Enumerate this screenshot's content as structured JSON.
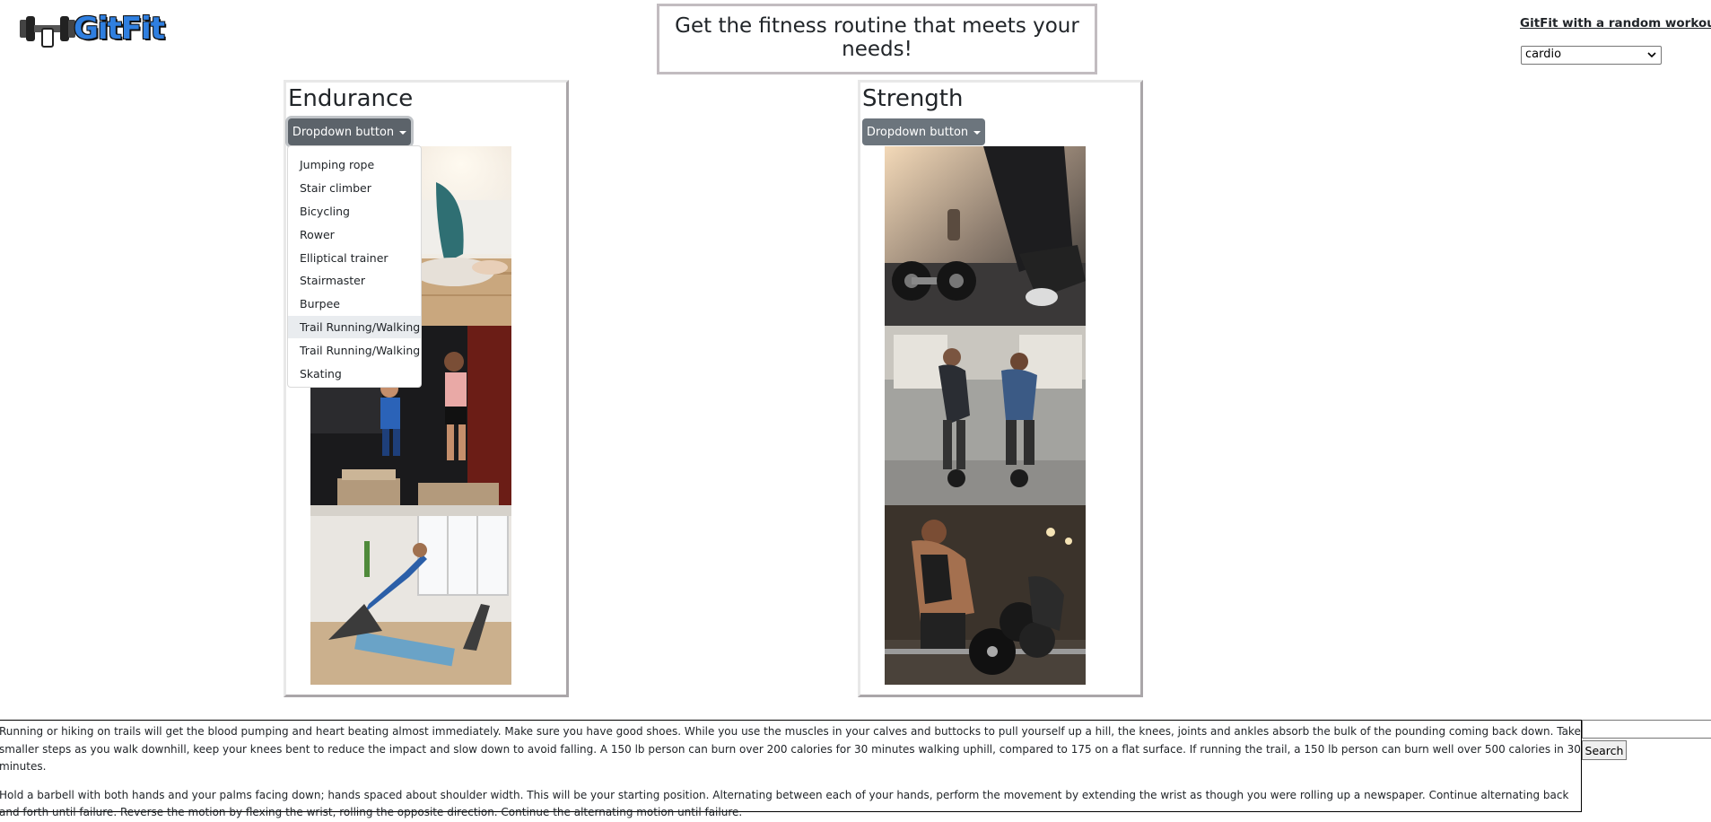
{
  "logo": {
    "text": "GitFit"
  },
  "header": {
    "title": "Get the fitness routine that meets your needs!"
  },
  "random": {
    "link_label": "GitFit with a random workout!",
    "selected_option": "cardio"
  },
  "endurance": {
    "title": "Endurance",
    "dropdown_label": "Dropdown button",
    "menu_items": [
      "Jumping rope",
      "Stair climber",
      "Bicycling",
      "Rower",
      "Elliptical trainer",
      "Stairmaster",
      "Burpee",
      "Trail Running/Walking",
      "Trail Running/Walking",
      "Skating"
    ],
    "photos": [
      "meditation-photo",
      "box-jump-photo",
      "yoga-class-photo"
    ]
  },
  "strength": {
    "title": "Strength",
    "dropdown_label": "Dropdown button",
    "photos": [
      "dumbbells-photo",
      "kettlebell-photo",
      "barbell-deadlift-photo"
    ]
  },
  "description": {
    "paragraphs": [
      "Running or hiking on trails will get the blood pumping and heart beating almost immediately. Make sure you have good shoes. While you use the muscles in your calves and buttocks to pull yourself up a hill, the knees, joints and ankles absorb the bulk of the pounding coming back down. Take smaller steps as you walk downhill, keep your knees bent to reduce the impact and slow down to avoid falling. A 150 lb person can burn over 200 calories for 30 minutes walking uphill, compared to 175 on a flat surface. If running the trail, a 150 lb person can burn well over 500 calories in 30 minutes.",
      "Hold a barbell with both hands and your palms facing down; hands spaced about shoulder width. This will be your starting position. Alternating between each of your hands, perform the movement by extending the wrist as though you were rolling up a newspaper. Continue alternating back and forth until failure. Reverse the motion by flexing the wrist, rolling the opposite direction. Continue the alternating motion until failure."
    ]
  },
  "search": {
    "button_label": "Search",
    "value": ""
  },
  "icons": {
    "logo": "dumbbell-icon",
    "select_chevron": "chevron-down-icon",
    "dropdown_caret": "caret-down-icon"
  }
}
